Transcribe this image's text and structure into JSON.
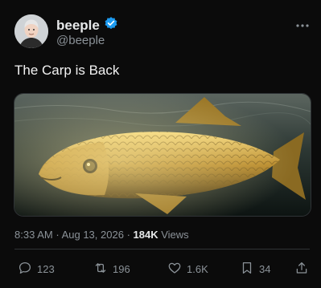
{
  "author": {
    "display_name": "beeple",
    "handle": "@beeple",
    "verified_badge_icon": "verified-badge-icon",
    "more_icon": "more-horizontal-icon"
  },
  "tweet": {
    "text": "The Carp is Back",
    "time": "8:33 AM",
    "separator": "·",
    "date": "Aug 13, 2026",
    "views_count": "184K",
    "views_label": "Views"
  },
  "actions": {
    "reply_count": "123",
    "retweet_count": "196",
    "like_count": "1.6K",
    "bookmark_count": "34"
  },
  "colors": {
    "background": "#0b0b0b",
    "text_primary": "#e7e9ea",
    "text_secondary": "#8b9298",
    "verified_blue": "#1d9bf0",
    "border": "#2f3336"
  }
}
